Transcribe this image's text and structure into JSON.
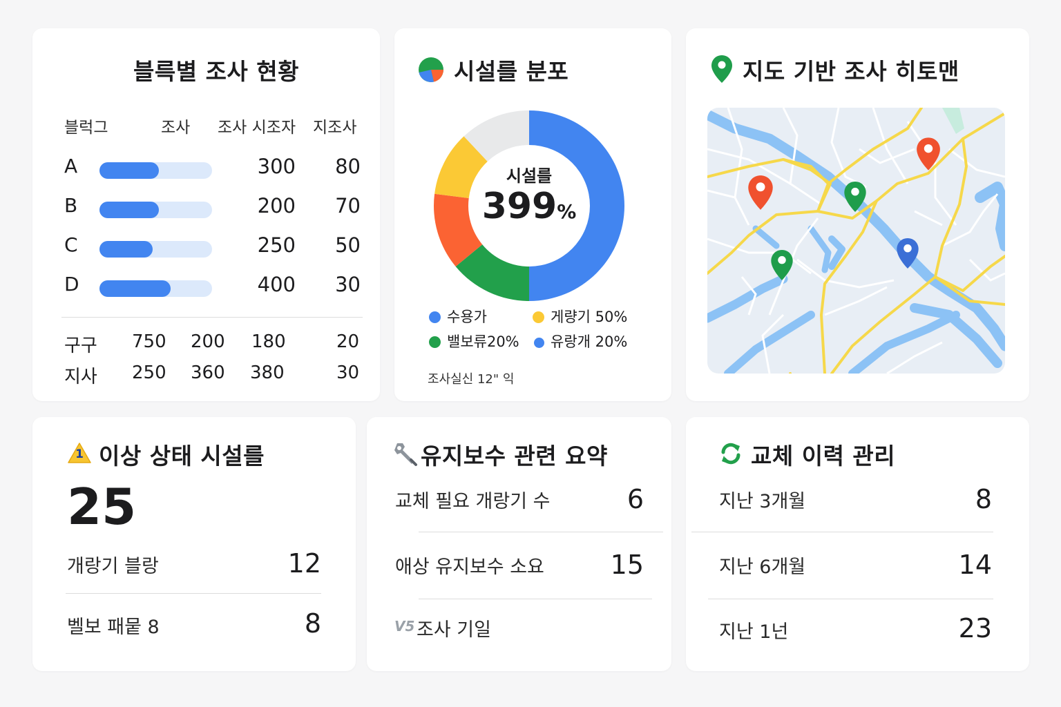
{
  "block_survey": {
    "title": "블륵별 조사 현황",
    "headers": [
      "블럭그",
      "조사",
      "조사 시조자",
      "지조사"
    ],
    "rows": [
      {
        "label": "A",
        "progress": 0.53,
        "value1": "300",
        "value2": "80"
      },
      {
        "label": "B",
        "progress": 0.53,
        "value1": "200",
        "value2": "70"
      },
      {
        "label": "C",
        "progress": 0.47,
        "value1": "250",
        "value2": "50"
      },
      {
        "label": "D",
        "progress": 0.63,
        "value1": "400",
        "value2": "30"
      }
    ],
    "footer_rows": [
      {
        "label": "구구",
        "c1": "750",
        "c2": "200",
        "c3": "180",
        "c4": "20"
      },
      {
        "label": "지사",
        "c1": "250",
        "c2": "360",
        "c3": "380",
        "c4": "30"
      }
    ]
  },
  "facility_dist": {
    "title": "시설를 분포",
    "center_label": "시설를",
    "center_value": "399",
    "center_unit": "%",
    "legend": [
      {
        "label": "수용가",
        "color": "#4285f0"
      },
      {
        "label": "게량기 50%",
        "color": "#fbc935"
      },
      {
        "label": "밸보류20%",
        "color": "#22a04b"
      },
      {
        "label": "유랑개 20%",
        "color": "#4285f0"
      }
    ],
    "note": "조사실신 12\" 익"
  },
  "chart_data": {
    "type": "pie",
    "donut": true,
    "categories": [
      "blue",
      "green",
      "orange",
      "yellow",
      "gray"
    ],
    "values": [
      50,
      14,
      13,
      11,
      12
    ],
    "colors": [
      "#4285f0",
      "#22a04b",
      "#fb6333",
      "#fbc935",
      "#e8e9ea"
    ]
  },
  "map": {
    "title": "지도 기반 조사 히토맨",
    "pin_icon": "map-pin-icon",
    "colors": {
      "land": "#e8eef5",
      "water": "#8cc2f5",
      "major_road": "#f6d84a",
      "minor_road": "#ffffff",
      "park": "#c7ecde"
    },
    "pins": [
      {
        "color": "#f0512e"
      },
      {
        "color": "#f0512e"
      },
      {
        "color": "#1f9d4b"
      },
      {
        "color": "#1f9d4b"
      },
      {
        "color": "#3b6fd6"
      }
    ]
  },
  "abnormal": {
    "title": "이상 상태 시설를",
    "icon": "warning-icon",
    "badge": "1",
    "total": "25",
    "rows": [
      {
        "label": "개랑기 블랑",
        "value": "12"
      },
      {
        "label": "벨보 패뭍 8",
        "value": "8"
      }
    ]
  },
  "maintenance": {
    "title": "유지보수 관련 요약",
    "icon": "wrench-icon",
    "rows": [
      {
        "label": "교체 필요 개랑기 수",
        "value": "6"
      },
      {
        "label": "애상 유지보수 소요",
        "value": "15"
      }
    ],
    "footer_icon_text": "V5",
    "footer_label": "조사 기일"
  },
  "replacement": {
    "title": "교체 이력 관리",
    "icon": "refresh-icon",
    "rows": [
      {
        "label": "지난 3개월",
        "value": "8"
      },
      {
        "label": "지난 6개월",
        "value": "14"
      },
      {
        "label": "지난 1넌",
        "value": "23"
      }
    ]
  }
}
